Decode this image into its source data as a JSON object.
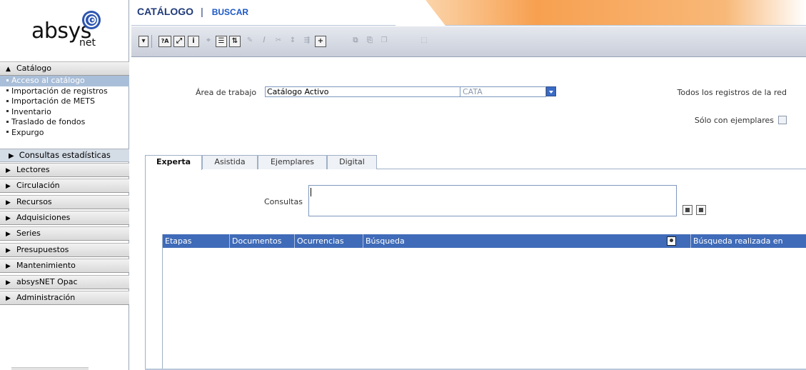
{
  "logo": {
    "word": "absys",
    "sub": "net"
  },
  "sidebar": {
    "catalogo_label": "Catálogo",
    "catalogo_items": [
      "Acceso al catálogo",
      "Importación de registros",
      "Importación de METS",
      "Inventario",
      "Traslado de fondos",
      "Expurgo"
    ],
    "consultas_label": "Consultas estadísticas",
    "sections": [
      "Lectores",
      "Circulación",
      "Recursos",
      "Adquisiciones",
      "Series",
      "Presupuestos",
      "Mantenimiento",
      "absysNET Opac",
      "Administración"
    ]
  },
  "header": {
    "module": "CATÁLOGO",
    "separator": "|",
    "action": "BUSCAR"
  },
  "toolbar": {
    "plus": "+",
    "info": "i",
    "help": "?A"
  },
  "main": {
    "area_label": "Área de trabajo",
    "area_value": "Catálogo Activo",
    "area_code": "CATA",
    "todos_label": "Todos los registros de la red",
    "solo_label": "Sólo con ejemplares",
    "tabs": [
      "Experta",
      "Asistida",
      "Ejemplares",
      "Digital"
    ],
    "consultas_label": "Consultas",
    "grid_headers": [
      "Etapas",
      "Documentos",
      "Ocurrencias",
      "Búsqueda",
      "Búsqueda realizada en"
    ]
  },
  "colors": {
    "accent": "#3f6bb8",
    "brand_orange": "#f7a050",
    "header_text": "#1f3a78"
  }
}
